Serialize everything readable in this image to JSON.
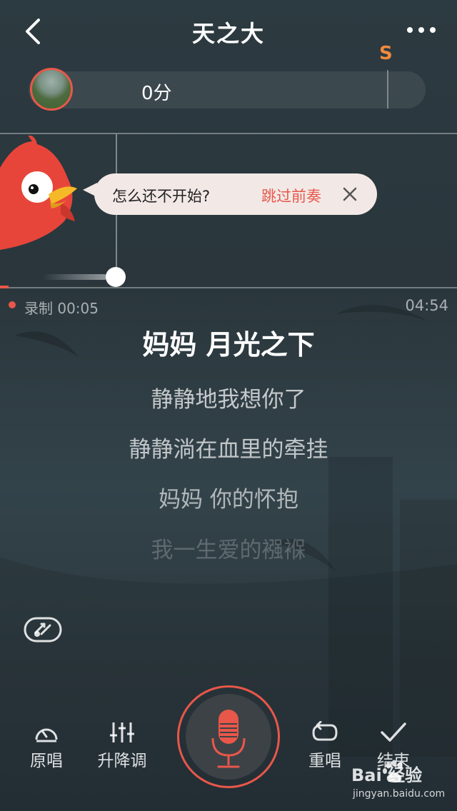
{
  "header": {
    "title": "天之大",
    "back_icon": "chevron-left-icon",
    "more_icon": "more-dots-icon"
  },
  "score": {
    "value": "0分",
    "grade_marker": "S"
  },
  "prompt_bubble": {
    "text": "怎么还不开始?",
    "skip_label": "跳过前奏",
    "close_icon": "close-icon"
  },
  "recording": {
    "label": "录制 00:05",
    "total": "04:54"
  },
  "lyrics": {
    "current": "妈妈 月光之下",
    "upcoming": [
      "静静地我想你了",
      "静静淌在血里的牵挂",
      "妈妈 你的怀抱",
      "我一生爱的襁褓"
    ]
  },
  "toolbar": {
    "original_label": "原唱",
    "pitch_label": "升降调",
    "retry_label": "重唱",
    "finish_label": "结束"
  },
  "watermark": {
    "brand": "Bai  经验",
    "url": "jingyan.baidu.com"
  },
  "colors": {
    "accent": "#e8574a",
    "grade": "#f08a3c"
  }
}
